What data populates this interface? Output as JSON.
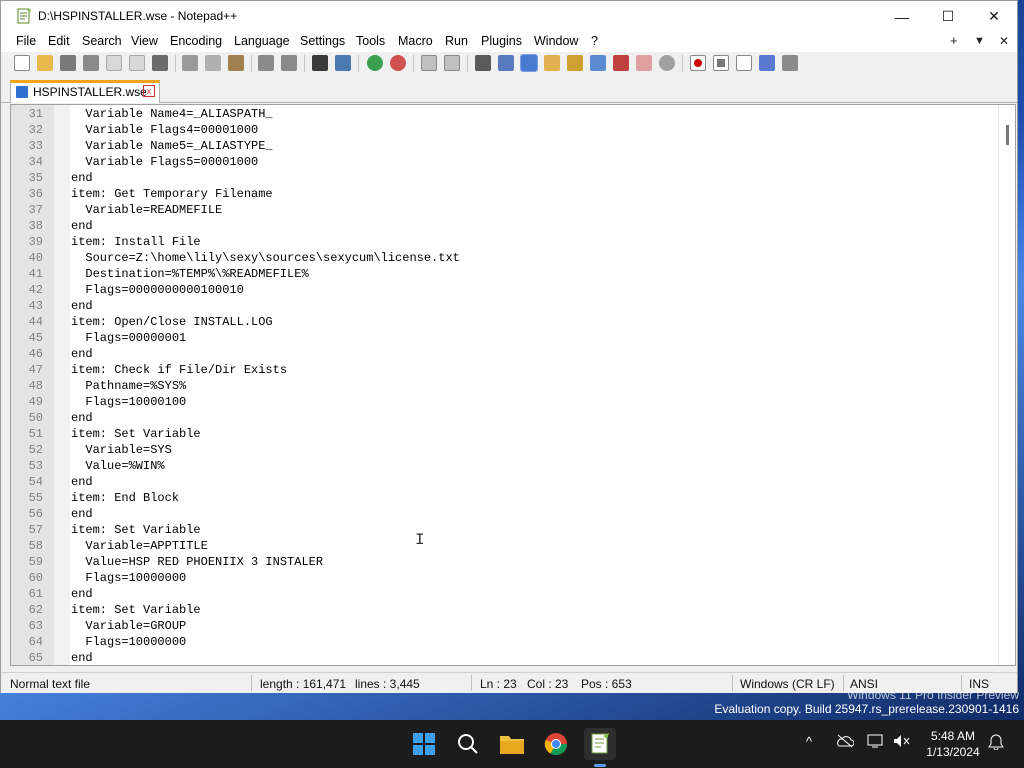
{
  "window": {
    "title": "D:\\HSPINSTALLER.wse - Notepad++",
    "minimize_glyph": "—",
    "maximize_glyph": "☐",
    "close_glyph": "✕"
  },
  "menu": {
    "items": [
      "File",
      "Edit",
      "Search",
      "View",
      "Encoding",
      "Language",
      "Settings",
      "Tools",
      "Macro",
      "Run",
      "Plugins",
      "Window",
      "?"
    ],
    "right": {
      "plus": "+",
      "down": "▼",
      "close": "✕"
    }
  },
  "toolbar": {
    "icons": [
      "new-file-icon",
      "open-file-icon",
      "save-icon",
      "save-all-icon",
      "close-icon",
      "close-all-icon",
      "print-icon",
      "cut-icon",
      "copy-icon",
      "paste-icon",
      "undo-icon",
      "redo-icon",
      "find-icon",
      "replace-icon",
      "zoom-in-icon",
      "zoom-out-icon",
      "sync-vertical-icon",
      "sync-horizontal-icon",
      "word-wrap-icon",
      "show-all-chars-icon",
      "indent-guide-icon",
      "language-define-icon",
      "doc-map-icon",
      "doc-list-icon",
      "function-list-icon",
      "folder-workspace-icon",
      "monitoring-icon",
      "record-macro-icon",
      "stop-macro-icon",
      "play-macro-icon",
      "run-macro-multiple-icon",
      "save-macro-icon"
    ]
  },
  "tab": {
    "label": "HSPINSTALLER.wse",
    "close": "x"
  },
  "editor": {
    "lines": [
      {
        "n": "31",
        "t": "  Variable Name4=_ALIASPATH_"
      },
      {
        "n": "32",
        "t": "  Variable Flags4=00001000"
      },
      {
        "n": "33",
        "t": "  Variable Name5=_ALIASTYPE_"
      },
      {
        "n": "34",
        "t": "  Variable Flags5=00001000"
      },
      {
        "n": "35",
        "t": "end"
      },
      {
        "n": "36",
        "t": "item: Get Temporary Filename"
      },
      {
        "n": "37",
        "t": "  Variable=READMEFILE"
      },
      {
        "n": "38",
        "t": "end"
      },
      {
        "n": "39",
        "t": "item: Install File"
      },
      {
        "n": "40",
        "t": "  Source=Z:\\home\\lily\\sexy\\sources\\sexycum\\license.txt"
      },
      {
        "n": "41",
        "t": "  Destination=%TEMP%\\%READMEFILE%"
      },
      {
        "n": "42",
        "t": "  Flags=0000000000100010"
      },
      {
        "n": "43",
        "t": "end"
      },
      {
        "n": "44",
        "t": "item: Open/Close INSTALL.LOG"
      },
      {
        "n": "45",
        "t": "  Flags=00000001"
      },
      {
        "n": "46",
        "t": "end"
      },
      {
        "n": "47",
        "t": "item: Check if File/Dir Exists"
      },
      {
        "n": "48",
        "t": "  Pathname=%SYS%"
      },
      {
        "n": "49",
        "t": "  Flags=10000100"
      },
      {
        "n": "50",
        "t": "end"
      },
      {
        "n": "51",
        "t": "item: Set Variable"
      },
      {
        "n": "52",
        "t": "  Variable=SYS"
      },
      {
        "n": "53",
        "t": "  Value=%WIN%"
      },
      {
        "n": "54",
        "t": "end"
      },
      {
        "n": "55",
        "t": "item: End Block"
      },
      {
        "n": "56",
        "t": "end"
      },
      {
        "n": "57",
        "t": "item: Set Variable"
      },
      {
        "n": "58",
        "t": "  Variable=APPTITLE"
      },
      {
        "n": "59",
        "t": "  Value=HSP RED PHOENIIX 3 INSTALER"
      },
      {
        "n": "60",
        "t": "  Flags=10000000"
      },
      {
        "n": "61",
        "t": "end"
      },
      {
        "n": "62",
        "t": "item: Set Variable"
      },
      {
        "n": "63",
        "t": "  Variable=GROUP"
      },
      {
        "n": "64",
        "t": "  Flags=10000000"
      },
      {
        "n": "65",
        "t": "end"
      }
    ]
  },
  "status": {
    "file_type": "Normal text file",
    "length": "length : 161,471",
    "lines": "lines : 3,445",
    "ln": "Ln : 23",
    "col": "Col : 23",
    "pos": "Pos : 653",
    "eol": "Windows (CR LF)",
    "encoding": "ANSI",
    "mode": "INS"
  },
  "watermark": {
    "line1": "Windows 11 Pro Insider Preview",
    "line2": "Evaluation copy. Build 25947.rs_prerelease.230901-1416"
  },
  "taskbar": {
    "icons": [
      "start-icon",
      "search-icon",
      "file-explorer-icon",
      "chrome-icon",
      "notepadpp-icon"
    ],
    "tray": {
      "chevron": "^",
      "time": "5:48 AM",
      "date": "1/13/2024"
    }
  },
  "colors": {
    "accent": "#f7a21b",
    "tab_close": "#cc3333"
  }
}
